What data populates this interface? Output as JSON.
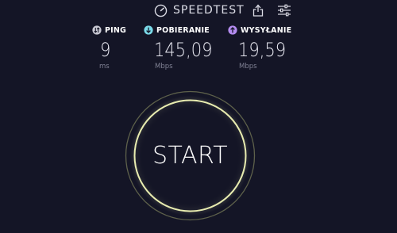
{
  "header": {
    "brand": "SPEEDTEST",
    "brand_icon": "speedometer-icon",
    "share_icon": "share-icon",
    "settings_icon": "settings-sliders-icon"
  },
  "metrics": {
    "ping": {
      "label": "PING",
      "value": "9",
      "unit": "ms",
      "icon": "ping-icon",
      "color": "#c8c8d2"
    },
    "download": {
      "label": "POBIERANIE",
      "value": "145,09",
      "unit": "Mbps",
      "icon": "download-arrow-icon",
      "color": "#7ad9e8"
    },
    "upload": {
      "label": "WYSYŁANIE",
      "value": "19,59",
      "unit": "Mbps",
      "icon": "upload-arrow-icon",
      "color": "#b48cf0"
    }
  },
  "start": {
    "label": "START",
    "ring_color": "#e8ecb0",
    "outer_ring_color": "#9aa06a"
  }
}
